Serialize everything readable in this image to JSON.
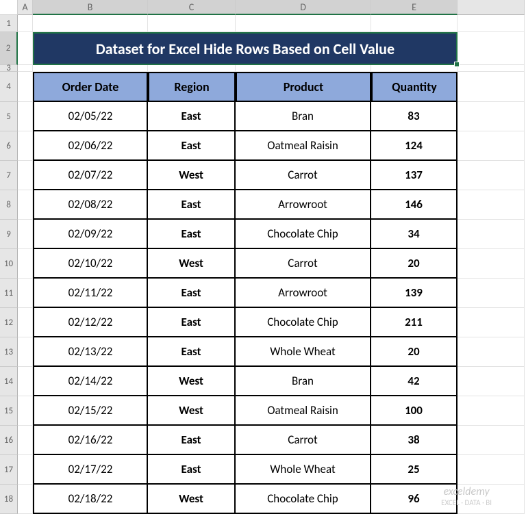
{
  "columns": {
    "A": "A",
    "B": "B",
    "C": "C",
    "D": "D",
    "E": "E"
  },
  "rowNumbers": [
    "1",
    "2",
    "3",
    "4",
    "5",
    "6",
    "7",
    "8",
    "9",
    "10",
    "11",
    "12",
    "13",
    "14",
    "15",
    "16",
    "17",
    "18"
  ],
  "title": "Dataset for Excel Hide Rows Based on Cell Value",
  "headers": {
    "orderDate": "Order Date",
    "region": "Region",
    "product": "Product",
    "quantity": "Quantity"
  },
  "rows": [
    {
      "date": "02/05/22",
      "region": "East",
      "product": "Bran",
      "qty": "83"
    },
    {
      "date": "02/06/22",
      "region": "East",
      "product": "Oatmeal Raisin",
      "qty": "124"
    },
    {
      "date": "02/07/22",
      "region": "West",
      "product": "Carrot",
      "qty": "137"
    },
    {
      "date": "02/08/22",
      "region": "East",
      "product": "Arrowroot",
      "qty": "146"
    },
    {
      "date": "02/09/22",
      "region": "East",
      "product": "Chocolate Chip",
      "qty": "34"
    },
    {
      "date": "02/10/22",
      "region": "West",
      "product": "Carrot",
      "qty": "20"
    },
    {
      "date": "02/11/22",
      "region": "East",
      "product": "Arrowroot",
      "qty": "139"
    },
    {
      "date": "02/12/22",
      "region": "East",
      "product": "Chocolate Chip",
      "qty": "211"
    },
    {
      "date": "02/13/22",
      "region": "East",
      "product": "Whole Wheat",
      "qty": "20"
    },
    {
      "date": "02/14/22",
      "region": "West",
      "product": "Bran",
      "qty": "42"
    },
    {
      "date": "02/15/22",
      "region": "West",
      "product": "Oatmeal Raisin",
      "qty": "100"
    },
    {
      "date": "02/16/22",
      "region": "East",
      "product": "Carrot",
      "qty": "38"
    },
    {
      "date": "02/17/22",
      "region": "East",
      "product": "Whole Wheat",
      "qty": "25"
    },
    {
      "date": "02/18/22",
      "region": "West",
      "product": "Chocolate Chip",
      "qty": "96"
    }
  ],
  "watermark": {
    "brand": "exceldemy",
    "tag": "EXCEL · DATA · BI"
  }
}
